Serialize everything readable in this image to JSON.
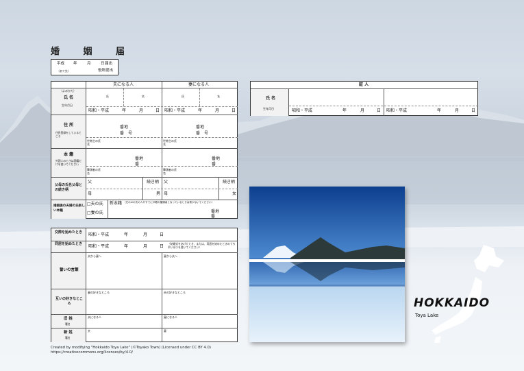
{
  "form_title": "婚 姻 届",
  "filing": {
    "era": "平成",
    "year": "年",
    "month": "月",
    "day": "日",
    "filed": "届出",
    "addressee_note": "（あて先）",
    "addressee": "役所提出"
  },
  "main": {
    "husband_header": "夫になる人",
    "wife_header": "妻になる人",
    "furigana": "（よみかた）",
    "name_label": "氏 名",
    "birth_label": "生年月日",
    "family_name": "氏",
    "given_name": "名",
    "birth_line": "昭和・平成",
    "year": "年",
    "month": "月",
    "day": "日",
    "address_label": "住 所",
    "address_note": "住民登録をしているところ",
    "banchi": "番地",
    "ban": "番　号",
    "householder": "世帯主の氏名",
    "honseki_label": "本 籍",
    "honseki_note": "外国人のときは国籍だけを書いてください",
    "hitsutousha": "筆頭者の氏名",
    "banchi2": "番地",
    "ban2": "番",
    "parents_label": "父母の氏名父母との続き柄",
    "father": "父",
    "mother": "母",
    "relationship": "続き柄",
    "son": "男",
    "daughter": "女",
    "surname_label": "婚姻後の夫婦の氏新しい本籍",
    "husband_surname": "□夫の氏",
    "wife_surname": "□妻の氏",
    "new_honseki": "新本籍",
    "new_honseki_note": "（左の☑の氏の人がすでに戸籍の筆頭者となっているときは書かないでください）",
    "banchi3": "番地",
    "ban3": "番"
  },
  "witness": {
    "header": "証 人",
    "name_label": "氏 名",
    "birth_label": "生年月日",
    "birth_line": "昭和・平成",
    "year": "年",
    "month": "月",
    "day": "日"
  },
  "bottom": {
    "dating_label": "交際を始めたとき",
    "cohab_label": "同居を始めたとき",
    "date_line": "昭和・平成",
    "year": "年",
    "month": "月",
    "day": "日",
    "cohab_note": "（結婚式をあげたとき、または、同居を始めたときのうち早いほうを書いてください）",
    "vows_label": "誓いの言葉",
    "vows_left": "夫から妻へ",
    "vows_right": "妻から夫へ",
    "likes_label": "互いの好きなところ",
    "likes_left": "妻の好きなところ",
    "likes_right": "夫の好きなところ",
    "old_surname_label": "旧 姓",
    "old_surname_sub": "署名",
    "new_surname_label": "新 姓",
    "new_surname_sub": "署名",
    "old_left": "夫になる人",
    "old_right": "妻になる人",
    "new_left": "夫",
    "new_right": "妻"
  },
  "credit_line1": "Created by modifying \"Hokkaido Toya Lake\" (©Toyako Town) (Licensed under CC BY 4.0)",
  "credit_line2": "https://creativecommons.org/licenses/by/4.0/",
  "brand": "HOKKAIDO",
  "location": "Toya Lake"
}
